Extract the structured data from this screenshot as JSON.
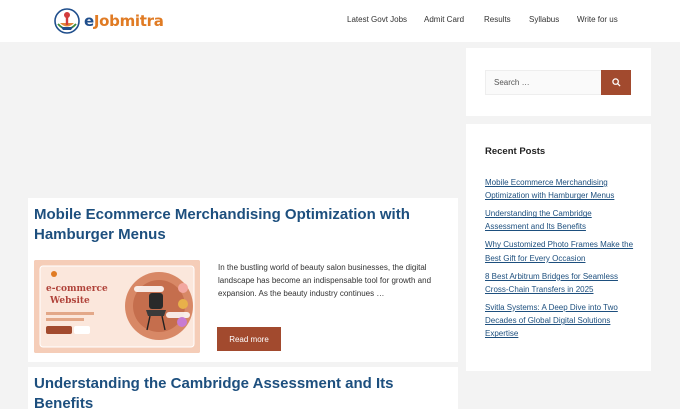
{
  "header": {
    "logo_text": "ejobmitra",
    "logo_e": "e",
    "logo_rest": "Jobmitra",
    "nav": [
      {
        "label": "Latest Govt Jobs"
      },
      {
        "label": "Admit Card"
      },
      {
        "label": "Results"
      },
      {
        "label": "Syllabus"
      },
      {
        "label": "Write for us"
      }
    ]
  },
  "posts": [
    {
      "title": "Mobile Ecommerce Merchandising Optimization with Hamburger Menus",
      "excerpt": "In the bustling world of beauty salon businesses, the digital landscape has become an indispensable tool for growth and expansion. As the beauty industry continues …",
      "read_more": "Read more",
      "thumbnail": {
        "title": "e-commerce",
        "subtitle": "Website"
      }
    },
    {
      "title": "Understanding the Cambridge Assessment and Its Benefits"
    }
  ],
  "sidebar": {
    "search": {
      "placeholder": "Search …",
      "button_icon": "search-icon"
    },
    "recent": {
      "title": "Recent Posts",
      "items": [
        "Mobile Ecommerce Merchandising Optimization with Hamburger Menus",
        "Understanding the Cambridge Assessment and Its Benefits",
        "Why Customized Photo Frames Make the Best Gift for Every Occasion",
        "8 Best Arbitrum Bridges for Seamless Cross-Chain Transfers in 2025",
        "Svitla Systems: A Deep Dive into Two Decades of Global Digital Solutions Expertise"
      ]
    }
  },
  "colors": {
    "accent": "#a24a2e",
    "link": "#1d4f7e",
    "logo_blue": "#1f4e8c",
    "logo_orange": "#e07b24"
  }
}
